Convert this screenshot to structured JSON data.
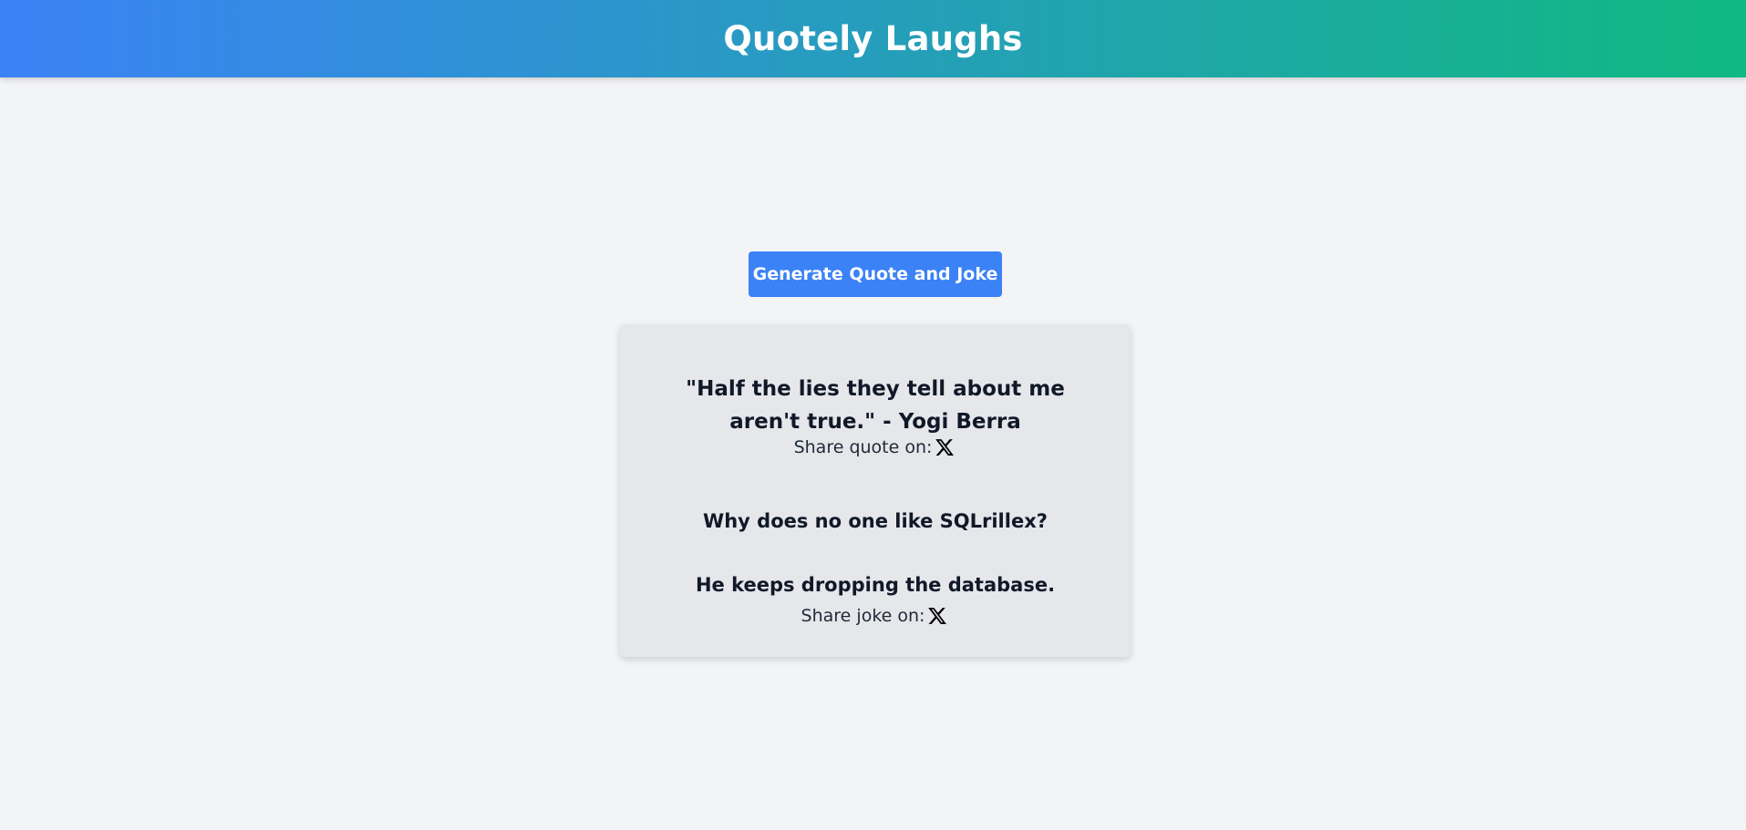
{
  "header": {
    "title": "Quotely Laughs"
  },
  "main": {
    "generate_label": "Generate Quote and Joke"
  },
  "quote": {
    "text": "\"Half the lies they tell about me aren't true.\" - Yogi Berra",
    "share_label": "Share quote on:",
    "share_icon": "x-logo-icon"
  },
  "joke": {
    "question": "Why does no one like SQLrillex?",
    "answer": "He keeps dropping the database.",
    "share_label": "Share joke on:",
    "share_icon": "x-logo-icon"
  },
  "colors": {
    "header_gradient_start": "#3b82f6",
    "header_gradient_end": "#10b981",
    "button_bg": "#3b82f6",
    "card_bg": "#e5e7eb",
    "page_bg": "#f3f4f6"
  }
}
